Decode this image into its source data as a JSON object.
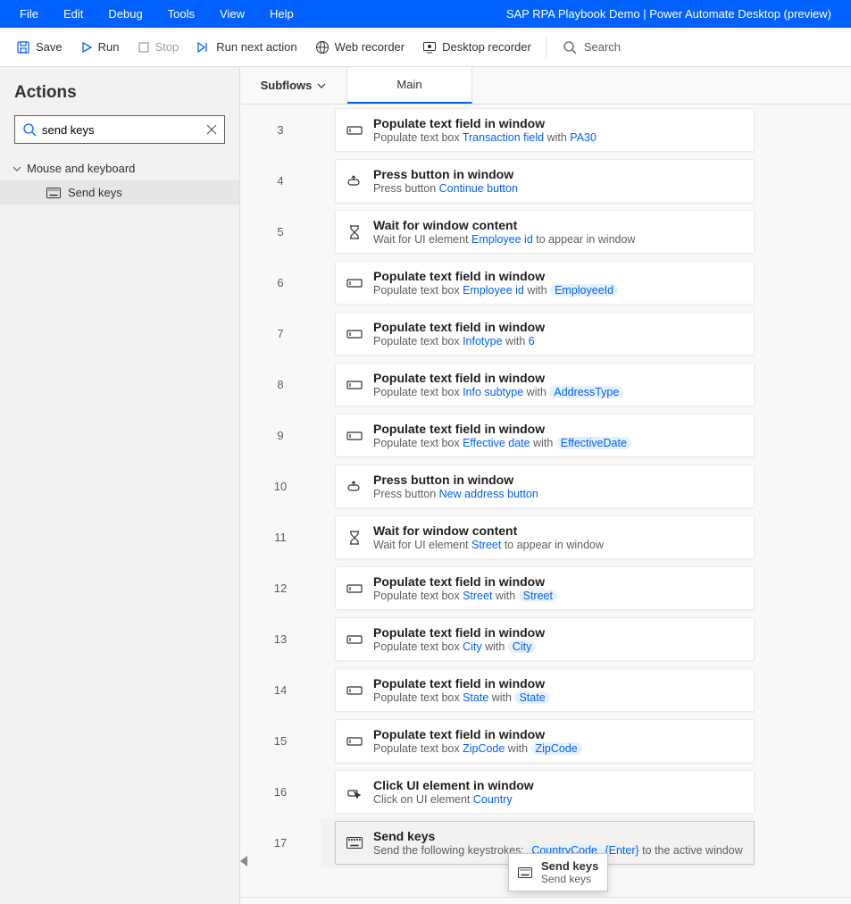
{
  "app_title": "SAP RPA Playbook Demo | Power Automate Desktop (preview)",
  "menu": {
    "file": "File",
    "edit": "Edit",
    "debug": "Debug",
    "tools": "Tools",
    "view": "View",
    "help": "Help"
  },
  "toolbar": {
    "save": "Save",
    "run": "Run",
    "stop": "Stop",
    "run_next": "Run next action",
    "web_rec": "Web recorder",
    "desk_rec": "Desktop recorder",
    "search": "Search"
  },
  "sidebar": {
    "heading": "Actions",
    "search_value": "send keys",
    "group": "Mouse and keyboard",
    "item": "Send keys"
  },
  "tabs": {
    "subflows": "Subflows",
    "main": "Main"
  },
  "steps": [
    {
      "n": "3",
      "icon": "textbox",
      "title": "Populate text field in window",
      "desc_parts": [
        "Populate text box ",
        {
          "link": "Transaction field"
        },
        " with ",
        {
          "link": "PA30"
        }
      ]
    },
    {
      "n": "4",
      "icon": "press",
      "title": "Press button in window",
      "desc_parts": [
        "Press button ",
        {
          "link": "Continue button"
        }
      ]
    },
    {
      "n": "5",
      "icon": "wait",
      "title": "Wait for window content",
      "desc_parts": [
        "Wait for UI element ",
        {
          "link": "Employee id"
        },
        " to appear in window"
      ]
    },
    {
      "n": "6",
      "icon": "textbox",
      "title": "Populate text field in window",
      "desc_parts": [
        "Populate text box ",
        {
          "link": "Employee id"
        },
        " with ",
        {
          "var": "EmployeeId"
        }
      ]
    },
    {
      "n": "7",
      "icon": "textbox",
      "title": "Populate text field in window",
      "desc_parts": [
        "Populate text box ",
        {
          "link": "Infotype"
        },
        " with ",
        {
          "link": "6"
        }
      ]
    },
    {
      "n": "8",
      "icon": "textbox",
      "title": "Populate text field in window",
      "desc_parts": [
        "Populate text box ",
        {
          "link": "Info subtype"
        },
        " with ",
        {
          "var": "AddressType"
        }
      ]
    },
    {
      "n": "9",
      "icon": "textbox",
      "title": "Populate text field in window",
      "desc_parts": [
        "Populate text box ",
        {
          "link": "Effective date"
        },
        " with ",
        {
          "var": "EffectiveDate"
        }
      ]
    },
    {
      "n": "10",
      "icon": "press",
      "title": "Press button in window",
      "desc_parts": [
        "Press button ",
        {
          "link": "New address button"
        }
      ]
    },
    {
      "n": "11",
      "icon": "wait",
      "title": "Wait for window content",
      "desc_parts": [
        "Wait for UI element ",
        {
          "link": "Street"
        },
        " to appear in window"
      ]
    },
    {
      "n": "12",
      "icon": "textbox",
      "title": "Populate text field in window",
      "desc_parts": [
        "Populate text box ",
        {
          "link": "Street"
        },
        " with ",
        {
          "var": "Street"
        }
      ]
    },
    {
      "n": "13",
      "icon": "textbox",
      "title": "Populate text field in window",
      "desc_parts": [
        "Populate text box ",
        {
          "link": "City"
        },
        " with ",
        {
          "var": "City"
        }
      ]
    },
    {
      "n": "14",
      "icon": "textbox",
      "title": "Populate text field in window",
      "desc_parts": [
        "Populate text box ",
        {
          "link": "State"
        },
        " with ",
        {
          "var": "State"
        }
      ]
    },
    {
      "n": "15",
      "icon": "textbox",
      "title": "Populate text field in window",
      "desc_parts": [
        "Populate text box ",
        {
          "link": "ZipCode"
        },
        " with ",
        {
          "var": "ZipCode"
        }
      ]
    },
    {
      "n": "16",
      "icon": "click",
      "title": "Click UI element in window",
      "desc_parts": [
        "Click on UI element ",
        {
          "link": "Country"
        }
      ]
    },
    {
      "n": "17",
      "icon": "keys",
      "title": "Send keys",
      "selected": true,
      "desc_parts": [
        "Send the following keystrokes: ",
        {
          "var": "CountryCode"
        },
        " ",
        {
          "link": "{Enter}"
        },
        " to the active window"
      ]
    }
  ],
  "tooltip": {
    "title": "Send keys",
    "desc": "Send keys"
  }
}
